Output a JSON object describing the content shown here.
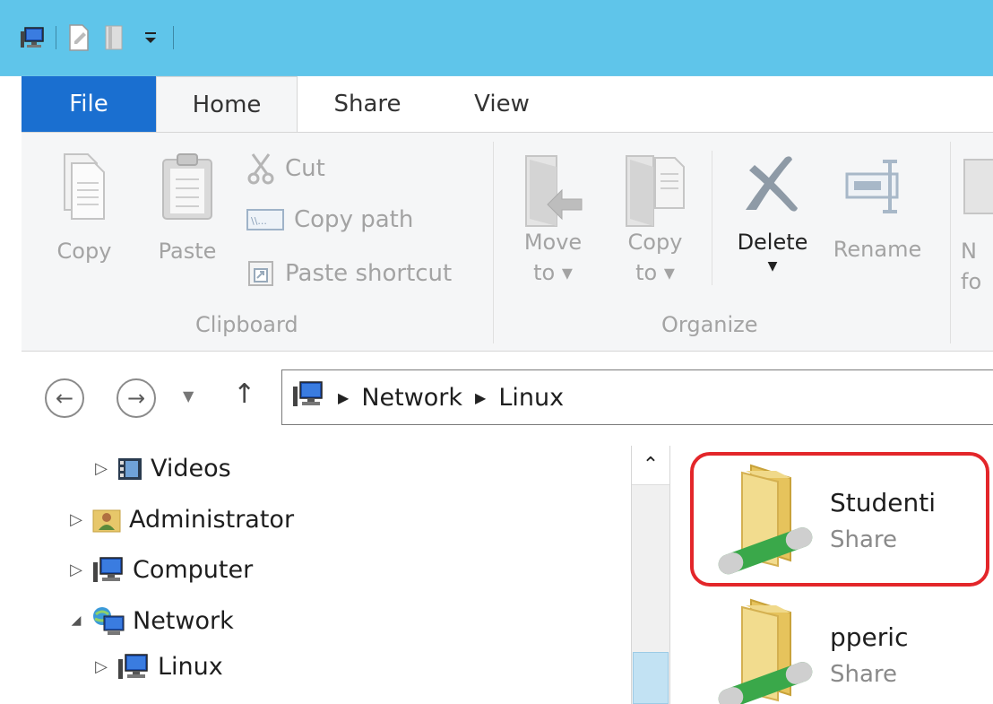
{
  "tabs": {
    "file": "File",
    "home": "Home",
    "share": "Share",
    "view": "View"
  },
  "ribbon": {
    "copy": "Copy",
    "paste": "Paste",
    "cut": "Cut",
    "copy_path": "Copy path",
    "paste_shortcut": "Paste shortcut",
    "clipboard_label": "Clipboard",
    "move_to": [
      "Move",
      "to ▾"
    ],
    "copy_to": [
      "Copy",
      "to ▾"
    ],
    "delete": "Delete",
    "rename": "Rename",
    "organize_label": "Organize",
    "partial": [
      "N",
      "fo"
    ]
  },
  "address": {
    "crumbs": [
      "Network",
      "Linux"
    ]
  },
  "tree": {
    "items": [
      {
        "label": "Videos",
        "expander": "▷"
      },
      {
        "label": "Administrator",
        "expander": "▷"
      },
      {
        "label": "Computer",
        "expander": "▷"
      },
      {
        "label": "Network",
        "expander": "◢"
      },
      {
        "label": "Linux",
        "expander": "▷"
      }
    ]
  },
  "files": [
    {
      "name": "Studenti",
      "type": "Share"
    },
    {
      "name": "pperic",
      "type": "Share"
    }
  ],
  "colors": {
    "title_bar": "#5fc5ea",
    "file_tab": "#1a6fd0",
    "highlight": "#e3262a"
  }
}
